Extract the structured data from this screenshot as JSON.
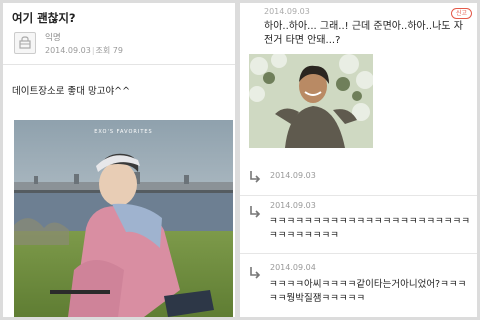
{
  "post": {
    "title": "여기 괜찮지?",
    "author": "익명",
    "date": "2014.09.03",
    "views_label": "조회 79",
    "body": "데이트장소로 좋대 망고야^^",
    "photo_caption": "EXO'S FAVORITES"
  },
  "comment": {
    "date": "2014.09.03",
    "report_label": "신고",
    "text": "하아..하아... 그래..! 근데 준면아..하아..나도 자전거 타면 안돼...?"
  },
  "replies": [
    {
      "date": "2014.09.03",
      "text": ""
    },
    {
      "date": "2014.09.03",
      "text": "ㅋㅋㅋㅋㅋㅋㅋㅋㅋㅋㅋㅋㅋㅋㅋㅋㅋㅋㅋㅋㅋㅋㅋㅋㅋㅋㅋㅋㅋㅋㅋ"
    },
    {
      "date": "2014.09.04",
      "text": "ㅋㅋㅋㅋ아씨ㅋㅋㅋㅋ같이타는거아니었어?ㅋㅋㅋㅋㅋ뭥박질잼ㅋㅋㅋㅋㅋ"
    }
  ],
  "icons": {
    "user": "user-placeholder-icon",
    "reply": "reply-arrow-icon"
  },
  "colors": {
    "accent_red": "#e45a4a",
    "meta_gray": "#999999",
    "divider": "#e6e6e6"
  }
}
